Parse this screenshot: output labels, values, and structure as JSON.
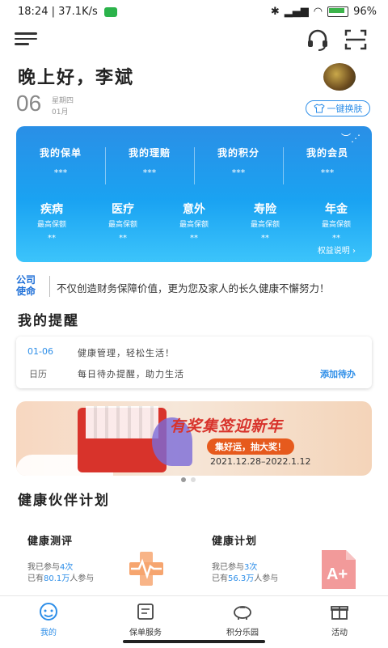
{
  "statusbar": {
    "time": "18:24",
    "speed": "37.1K/s",
    "battery": "96%"
  },
  "header": {
    "greeting": "晚上好，李斌",
    "day": "06",
    "weekday": "星期四",
    "month": "01月",
    "skin_button": "一键换肤"
  },
  "card": {
    "top": [
      {
        "label": "我的保单",
        "value": "***"
      },
      {
        "label": "我的理赔",
        "value": "***"
      },
      {
        "label": "我的积分",
        "value": "***"
      },
      {
        "label": "我的会员",
        "value": "***"
      }
    ],
    "bottom": [
      {
        "label": "疾病",
        "sub": "最高保额",
        "value": "**"
      },
      {
        "label": "医疗",
        "sub": "最高保额",
        "value": "**"
      },
      {
        "label": "意外",
        "sub": "最高保额",
        "value": "**"
      },
      {
        "label": "寿险",
        "sub": "最高保额",
        "value": "**"
      },
      {
        "label": "年金",
        "sub": "最高保额",
        "value": "**"
      }
    ],
    "rights_link": "权益说明 ›"
  },
  "mission": {
    "logo_line1": "公司",
    "logo_line2": "使命",
    "text": "不仅创造财务保障价值，更为您及家人的长久健康不懈努力！"
  },
  "reminder": {
    "title": "我的提醒",
    "date": "01-06",
    "line1": "健康管理，轻松生活！",
    "calendar_label": "日历",
    "line2": "每日待办提醒，助力生活",
    "add_button": "添加待办"
  },
  "banner": {
    "title": "有奖集签迎新年",
    "subtitle": "集好运，抽大奖！",
    "dates": "2021.12.28–2022.1.12"
  },
  "health": {
    "title": "健康伙伴计划",
    "cards": [
      {
        "title": "健康测评",
        "line1_pre": "我已参与",
        "line1_num": "4次",
        "line2_pre": "已有",
        "line2_num": "80.1万",
        "line2_post": "人参与"
      },
      {
        "title": "健康计划",
        "line1_pre": "我已参与",
        "line1_num": "3次",
        "line2_pre": "已有",
        "line2_num": "56.3万",
        "line2_post": "人参与"
      }
    ]
  },
  "tabbar": {
    "tabs": [
      "我的",
      "保单服务",
      "积分乐园",
      "活动"
    ],
    "active": "我的"
  },
  "colors": {
    "accent": "#2d8ee8",
    "card_top": "#2a8fe6",
    "card_bottom": "#3cc4fb",
    "banner_red": "#d8332b"
  },
  "icons": [
    "menu-icon",
    "headset-icon",
    "scan-icon",
    "shirt-icon",
    "eye-icon",
    "chevron-right-icon",
    "pulse-icon",
    "grade-icon",
    "user-icon",
    "policy-icon",
    "piggy-bank-icon",
    "gift-icon"
  ]
}
